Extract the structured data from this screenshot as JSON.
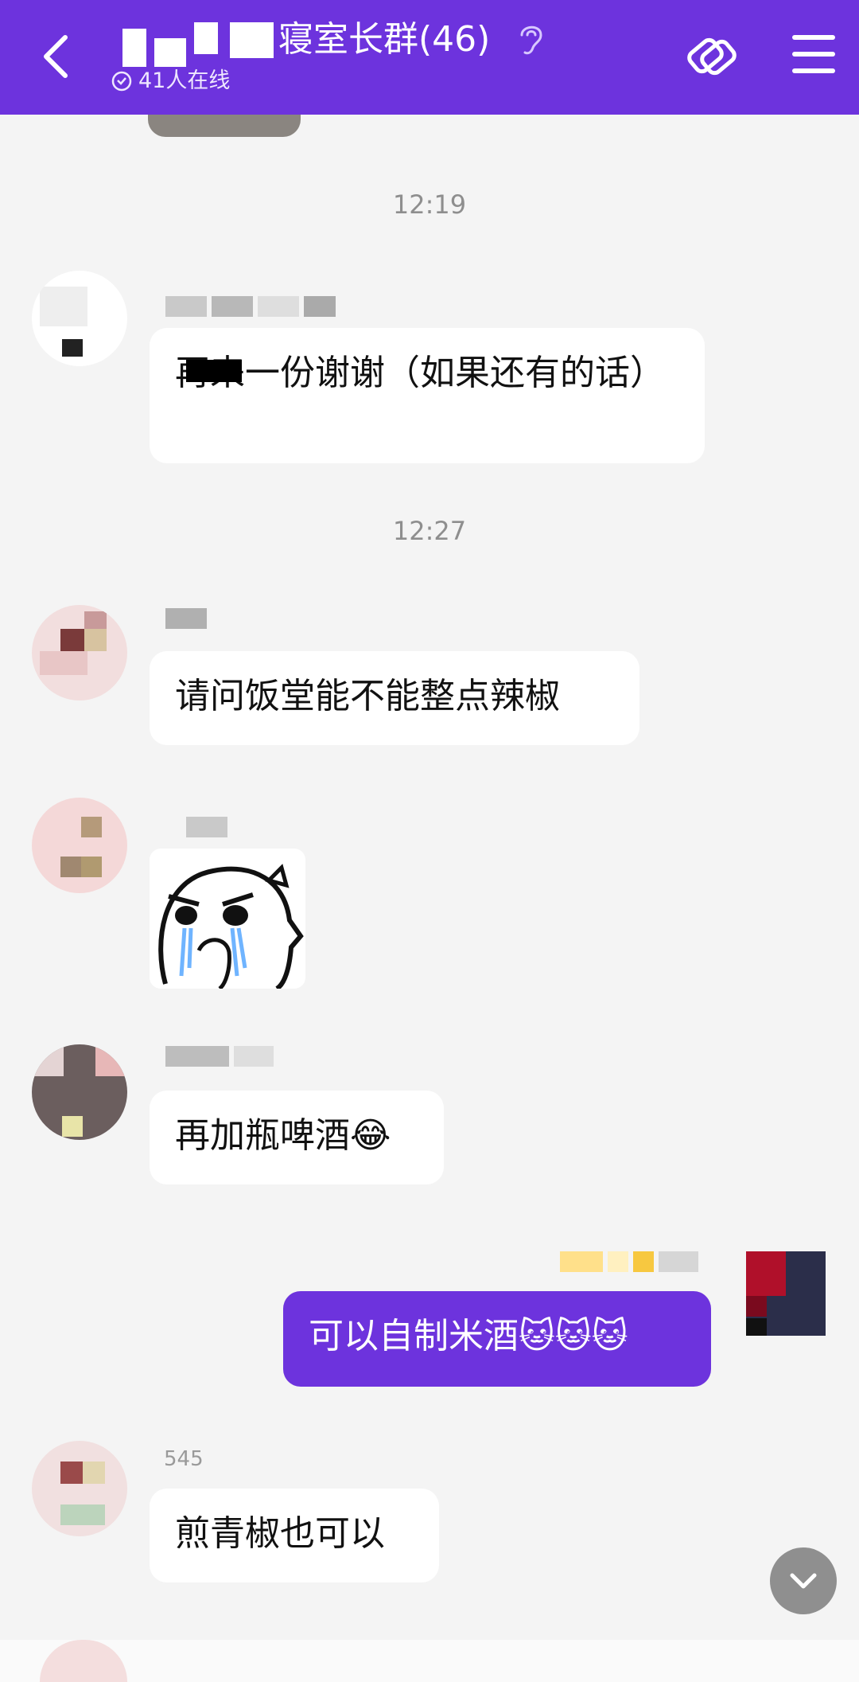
{
  "header": {
    "title": "寝室长群(46)",
    "online": "41人在线",
    "bg_color": "#6d33dd"
  },
  "messages": [
    {
      "time": "12:19"
    },
    {
      "text": "再来一份谢谢（如果还有的话）"
    },
    {
      "time": "12:27"
    },
    {
      "text": "请问饭堂能不能整点辣椒"
    },
    {
      "sticker": "crying-face-sticker"
    },
    {
      "text": "再加瓶啤酒😂"
    },
    {
      "text": "可以自制米酒🐱🐱🐱",
      "self": true
    },
    {
      "nick": "545",
      "text": "煎青椒也可以"
    }
  ],
  "icons": {
    "back": "chevron-left-icon",
    "ear": "ear-icon",
    "link": "link-icon",
    "menu": "menu-icon",
    "scroll": "chevron-down-icon"
  }
}
